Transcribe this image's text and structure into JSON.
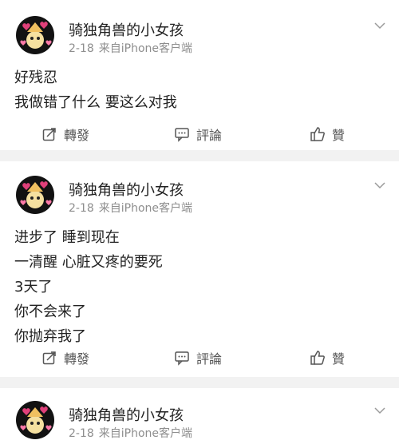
{
  "posts": [
    {
      "author": "骑独角兽的小女孩",
      "date": "2-18",
      "source": "来自iPhone客户端",
      "lines": [
        "好残忍",
        "我做错了什么 要这么对我"
      ],
      "actions": {
        "repost": "轉發",
        "comment": "評論",
        "like": "贊"
      }
    },
    {
      "author": "骑独角兽的小女孩",
      "date": "2-18",
      "source": "来自iPhone客户端",
      "lines": [
        "进步了 睡到现在",
        "一清醒 心脏又疼的要死",
        "3天了",
        "你不会来了",
        "你抛弃我了"
      ],
      "actions": {
        "repost": "轉發",
        "comment": "評論",
        "like": "贊"
      }
    },
    {
      "author": "骑独角兽的小女孩",
      "date": "2-18",
      "source": "来自iPhone客户端"
    }
  ]
}
